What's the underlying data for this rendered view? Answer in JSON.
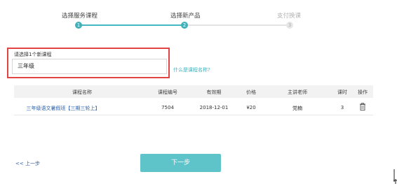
{
  "stepper": {
    "steps": [
      {
        "label": "选择服务课程",
        "number": "1",
        "state": "done"
      },
      {
        "label": "选择新产品",
        "number": "2",
        "state": "current"
      },
      {
        "label": "支付换课",
        "number": "3",
        "state": "pending"
      }
    ]
  },
  "course_select": {
    "label": "请选择1个新课程",
    "value": "三年级"
  },
  "help_link": "什么是课程名称?",
  "table": {
    "headers": [
      "课程名称",
      "课程编号",
      "有效期",
      "价格",
      "主讲老师",
      "课时",
      "操作"
    ],
    "rows": [
      {
        "name": "三年级语文暑假班【三期三轮上】",
        "code": "7504",
        "expiry": "2018-12-01",
        "price": "¥20",
        "teacher": "党楠",
        "hours": "3",
        "action_icon": "trash-icon"
      }
    ]
  },
  "nav": {
    "prev_label": "<< 上一步",
    "next_label": "下一步"
  },
  "colors": {
    "accent": "#45b5bf",
    "next_button": "#5ec4c9",
    "highlight_border": "#e24444",
    "link": "#2a5fa8"
  }
}
